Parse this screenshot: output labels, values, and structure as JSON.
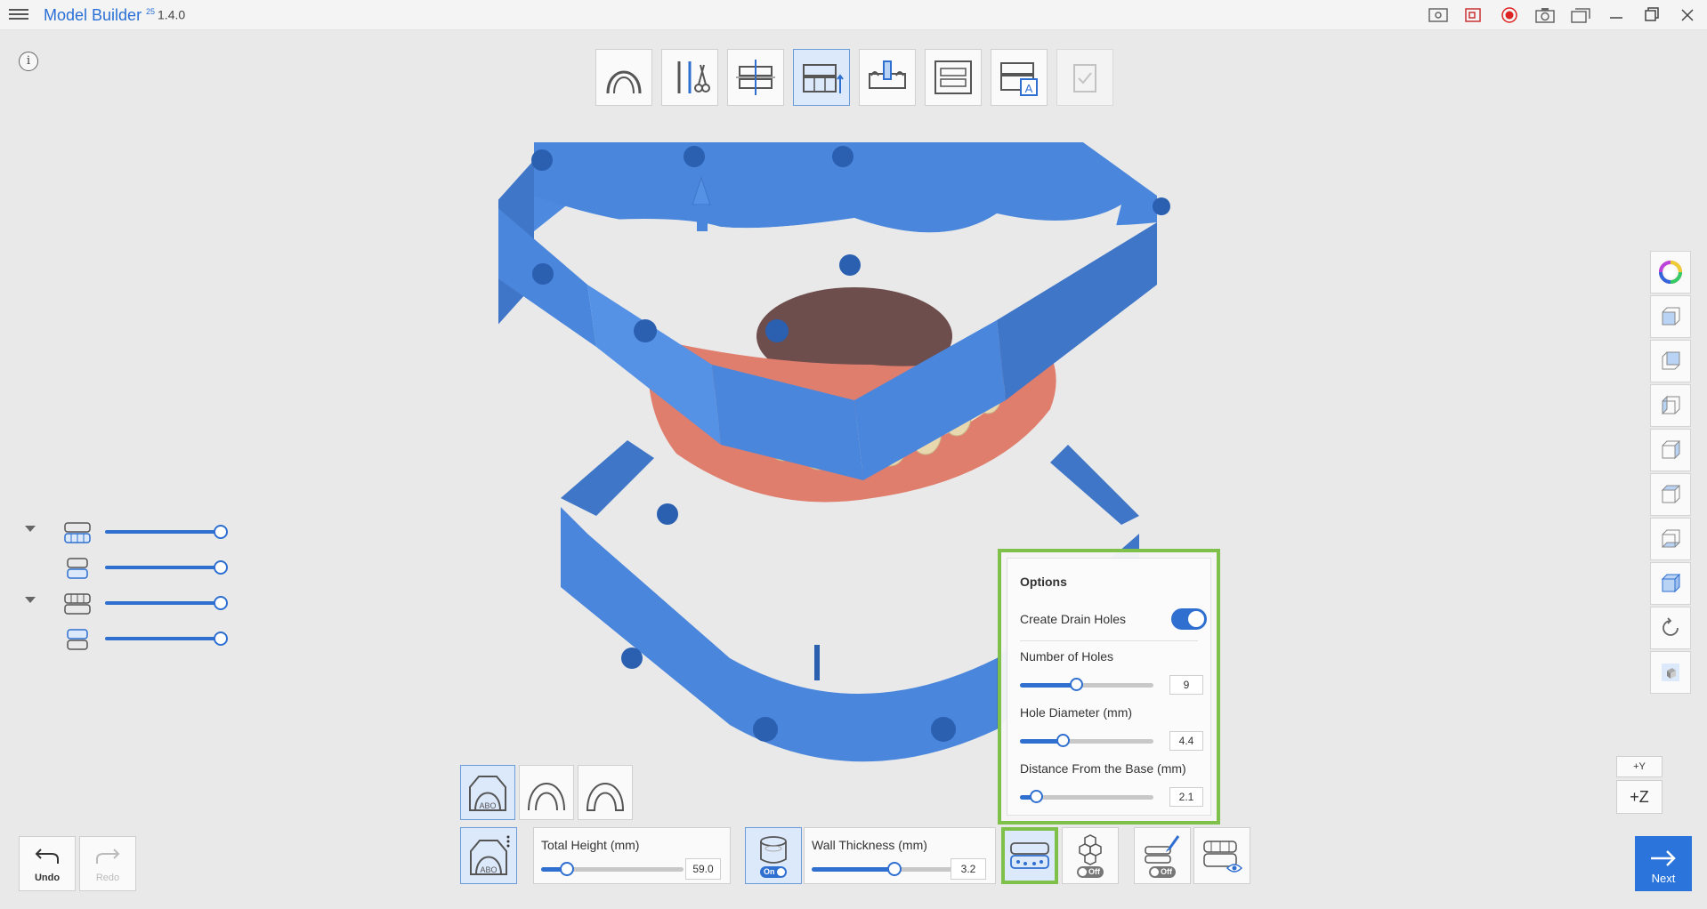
{
  "app": {
    "title": "Model Builder",
    "superscript": "25",
    "version": "1.4.0"
  },
  "titlebar_icons": [
    "screen-capture-icon",
    "video-capture-icon",
    "record-icon",
    "camera-icon",
    "gallery-icon",
    "minimize-icon",
    "restore-icon",
    "close-icon"
  ],
  "info_icon_text": "i",
  "steps": [
    {
      "name": "scan-arch-step",
      "active": false
    },
    {
      "name": "trim-tools-step",
      "active": false
    },
    {
      "name": "occlusion-plane-step",
      "active": false
    },
    {
      "name": "base-height-step",
      "active": true
    },
    {
      "name": "die-step",
      "active": false
    },
    {
      "name": "articulator-step",
      "active": false
    },
    {
      "name": "label-step",
      "active": false
    },
    {
      "name": "finish-step",
      "active": false
    }
  ],
  "view_tools": [
    "color-wheel-icon",
    "front-view-icon",
    "back-view-icon",
    "left-view-icon",
    "right-view-icon",
    "top-view-icon",
    "bottom-view-icon",
    "iso-view-icon",
    "rotate-icon",
    "cube-view-icon"
  ],
  "axis": {
    "y_label": "+Y",
    "z_label": "+Z"
  },
  "visibility": [
    {
      "caret": true,
      "level": 1.0
    },
    {
      "caret": false,
      "level": 1.0
    },
    {
      "caret": true,
      "level": 1.0
    },
    {
      "caret": false,
      "level": 1.0
    }
  ],
  "undo": {
    "label": "Undo"
  },
  "redo": {
    "label": "Redo"
  },
  "base_types": [
    {
      "badge": "ABO",
      "active": true
    },
    {
      "badge": "",
      "active": false
    },
    {
      "badge": "",
      "active": false
    }
  ],
  "base_settings_badge": "ABO",
  "total_height": {
    "label": "Total Height (mm)",
    "value": "59.0",
    "level": 0.18
  },
  "hollow_toggle": {
    "state": "On"
  },
  "wall_thickness": {
    "label": "Wall Thickness (mm)",
    "value": "3.2",
    "level": 0.58
  },
  "drain_tool": {
    "state": "active"
  },
  "honeycomb_tool": {
    "state": "Off"
  },
  "brush_tool": {
    "state": "Off"
  },
  "preview_tool": {
    "state": "view"
  },
  "next": {
    "label": "Next"
  },
  "options": {
    "title": "Options",
    "create_drain_holes": {
      "label": "Create Drain Holes",
      "enabled": true
    },
    "number_of_holes": {
      "label": "Number of Holes",
      "value": "9",
      "level": 0.42
    },
    "hole_diameter": {
      "label": "Hole Diameter (mm)",
      "value": "4.4",
      "level": 0.32
    },
    "distance_from_base": {
      "label": "Distance From the Base (mm)",
      "value": "2.1",
      "level": 0.12
    }
  },
  "colors": {
    "accent": "#2a74dc",
    "base_blue": "#4a86dc",
    "gum": "#e07e6e",
    "tooth": "#efe3c2",
    "highlight": "#7fc04a"
  }
}
